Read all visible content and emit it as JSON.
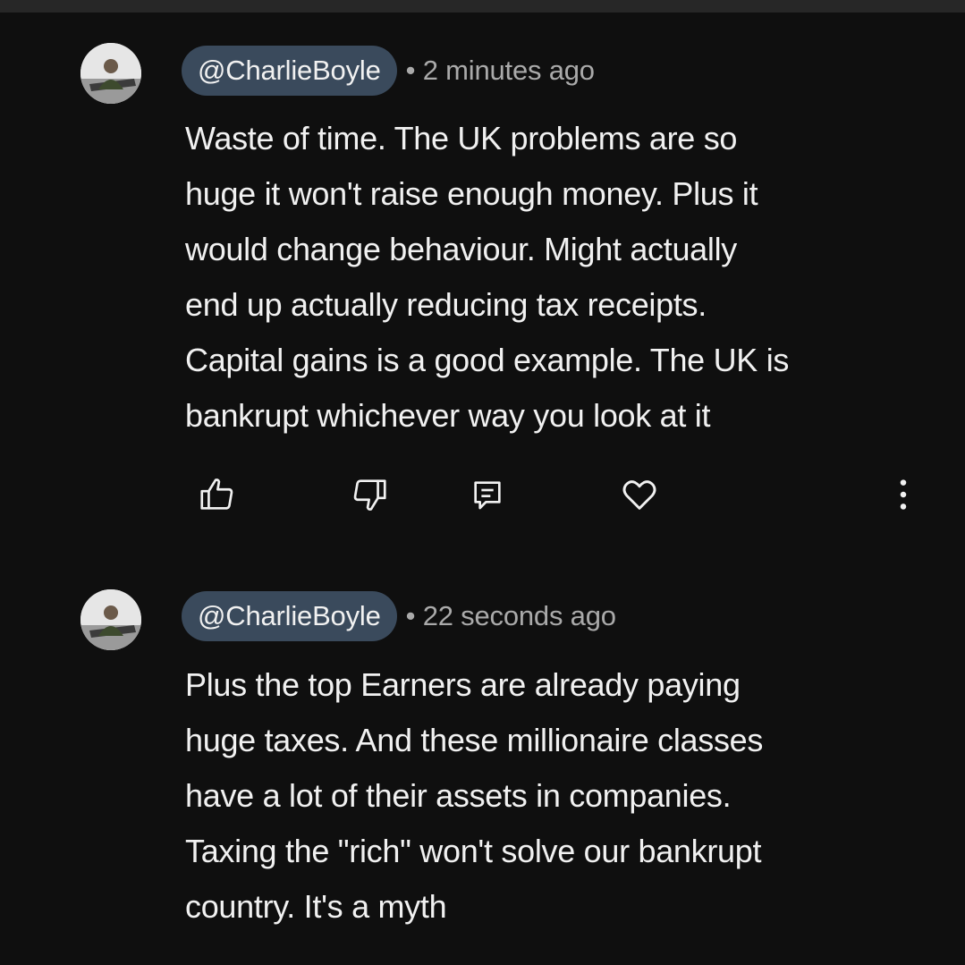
{
  "comments": [
    {
      "handle": "@CharlieBoyle",
      "timestamp": "• 2 minutes ago",
      "text": "Waste of time. The UK problems are so\nhuge it won't raise enough money. Plus it\nwould change behaviour. Might actually\nend up actually reducing tax receipts.\nCapital gains is a good example. The UK is\nbankrupt whichever way you look at it",
      "actions": [
        "like-icon",
        "dislike-icon",
        "reply-icon",
        "heart-icon",
        "more-vert-icon"
      ]
    },
    {
      "handle": "@CharlieBoyle",
      "timestamp": "• 22 seconds ago",
      "text": "Plus the top Earners are already paying\nhuge taxes. And these millionaire classes\nhave a lot of their assets in companies.\nTaxing the \"rich\" won't solve our bankrupt\ncountry. It's a myth"
    }
  ],
  "colors": {
    "background": "#0f0f0f",
    "handle_chip": "#3a4a5c",
    "text": "#f1f1f1",
    "muted": "#aaaaaa"
  }
}
